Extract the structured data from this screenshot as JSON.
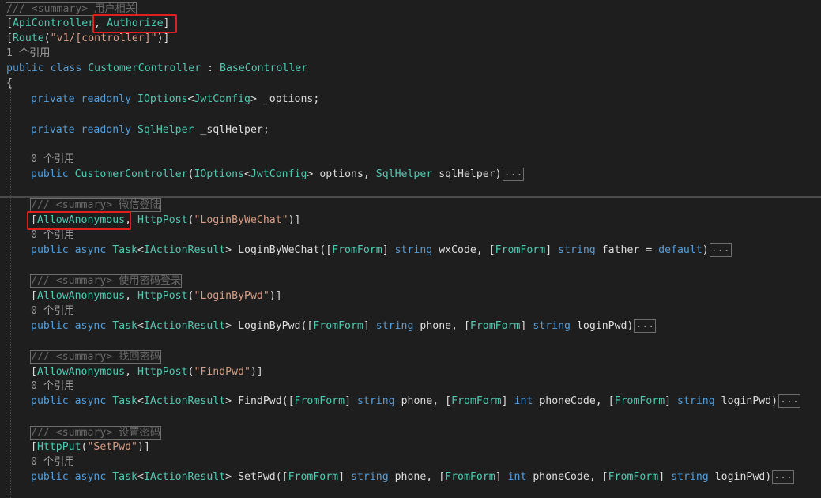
{
  "code": {
    "summary1": "/// <summary> 用户相关",
    "apicontroller": "ApiController",
    "authorize": "Authorize",
    "route": "Route",
    "route_path": "\"v1/[controller]\"",
    "refs1": "1 个引用",
    "class_kw": "public class",
    "class_name": "CustomerController",
    "base_class": "BaseController",
    "field1_kw": "private readonly",
    "field1_type": "IOptions",
    "field1_generic": "JwtConfig",
    "field1_name": "_options;",
    "field2_kw": "private readonly",
    "field2_type": "SqlHelper",
    "field2_name": "_sqlHelper;",
    "refs0": "0 个引用",
    "ctor_kw": "public",
    "ctor_name": "CustomerController",
    "ctor_param_type": "IOptions",
    "ctor_param_generic": "JwtConfig",
    "ctor_param1": "options,",
    "ctor_param2_type": "SqlHelper",
    "ctor_param2": "sqlHelper)",
    "fold": "...",
    "summary_wechat": "/// <summary> 微信登陆",
    "allow_anonymous": "AllowAnonymous",
    "httppost": "HttpPost",
    "login_wechat_route": "\"LoginByWeChat\"",
    "method_kw": "public async",
    "task": "Task",
    "iactionresult": "IActionResult",
    "m1_name": "LoginByWeChat(",
    "fromform": "FromForm",
    "string_kw": "string",
    "int_kw": "int",
    "m1_p1": "wxCode,",
    "m1_p2": "father =",
    "default_kw": "default",
    "summary_pwd": "/// <summary> 使用密码登录",
    "login_pwd_route": "\"LoginByPwd\"",
    "m2_name": "LoginByPwd(",
    "p_phone": "phone,",
    "p_loginpwd": "loginPwd)",
    "summary_find": "/// <summary> 找回密码",
    "find_pwd_route": "\"FindPwd\"",
    "m3_name": "FindPwd(",
    "p_phonecode": "phoneCode,",
    "summary_set": "/// <summary> 设置密码",
    "httpput": "HttpPut",
    "set_pwd_route": "\"SetPwd\"",
    "m4_name": "SetPwd("
  },
  "colors": {
    "background": "#1e1e1e",
    "keyword": "#569cd6",
    "type": "#4ec9b0",
    "string": "#d69d85",
    "comment": "#6a6a6a",
    "highlight_box": "#e02020"
  }
}
